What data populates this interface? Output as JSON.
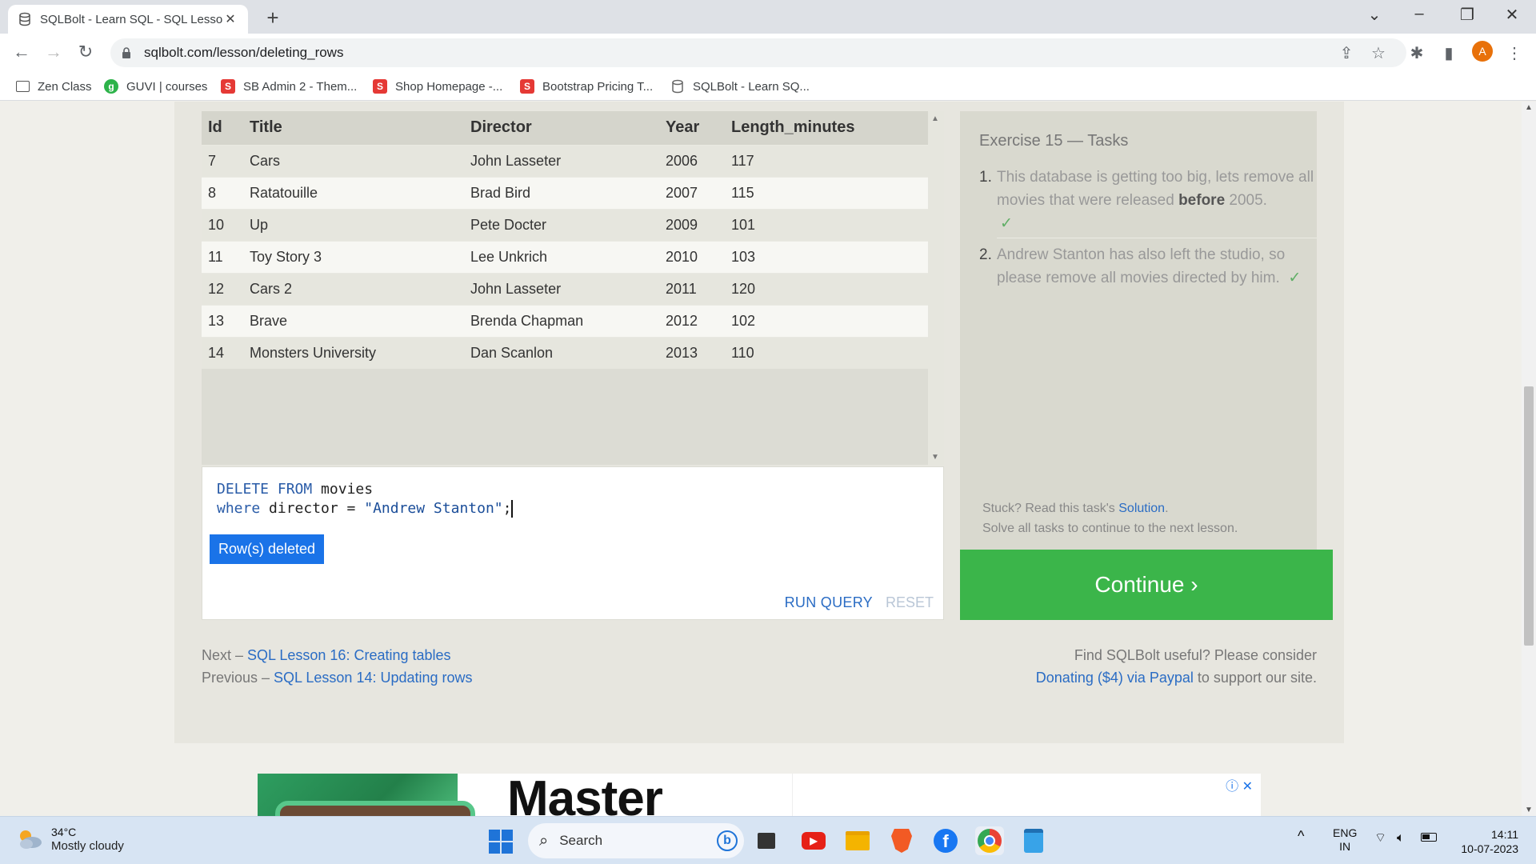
{
  "browser": {
    "tab_title": "SQLBolt - Learn SQL - SQL Lesso",
    "url": "sqlbolt.com/lesson/deleting_rows",
    "profile_initial": "A",
    "bookmarks": [
      {
        "label": "Zen Class",
        "icon_color": "#555555",
        "icon": ""
      },
      {
        "label": "GUVI | courses",
        "icon_color": "#2db34a",
        "icon": "g"
      },
      {
        "label": "SB Admin 2 - Them...",
        "icon_color": "#e53935",
        "icon": "S"
      },
      {
        "label": "Shop Homepage -...",
        "icon_color": "#e53935",
        "icon": "S"
      },
      {
        "label": "Bootstrap Pricing T...",
        "icon_color": "#e53935",
        "icon": "S"
      },
      {
        "label": "SQLBolt - Learn SQ...",
        "icon_color": "#666666",
        "icon": ""
      }
    ]
  },
  "results": {
    "columns": [
      "Id",
      "Title",
      "Director",
      "Year",
      "Length_minutes"
    ],
    "rows": [
      [
        "7",
        "Cars",
        "John Lasseter",
        "2006",
        "117"
      ],
      [
        "8",
        "Ratatouille",
        "Brad Bird",
        "2007",
        "115"
      ],
      [
        "10",
        "Up",
        "Pete Docter",
        "2009",
        "101"
      ],
      [
        "11",
        "Toy Story 3",
        "Lee Unkrich",
        "2010",
        "103"
      ],
      [
        "12",
        "Cars 2",
        "John Lasseter",
        "2011",
        "120"
      ],
      [
        "13",
        "Brave",
        "Brenda Chapman",
        "2012",
        "102"
      ],
      [
        "14",
        "Monsters University",
        "Dan Scanlon",
        "2013",
        "110"
      ]
    ],
    "status": "Row(s) deleted"
  },
  "editor": {
    "line1_kw": "DELETE FROM",
    "line1_rest": " movies",
    "line2_kw": "where",
    "line2_mid": " director = ",
    "line2_str": "\"Andrew Stanton\"",
    "line2_end": ";",
    "run_label": "RUN QUERY",
    "reset_label": "RESET"
  },
  "tasks": {
    "title": "Exercise 15 — Tasks",
    "task1": {
      "num": "1.",
      "pre": "This database is getting too big, lets remove all movies that were released ",
      "bold": "before",
      "post": " 2005.",
      "check": "✓"
    },
    "task2": {
      "num": "2.",
      "text": "Andrew Stanton has also left the studio, so please remove all movies directed by him.",
      "check": "✓"
    },
    "stuck_pre": "Stuck? Read this task's ",
    "stuck_link": "Solution",
    "stuck_post": ".",
    "solve_note": "Solve all tasks to continue to the next lesson.",
    "continue_label": "Continue ›"
  },
  "nav": {
    "next_prefix": "Next – ",
    "next_link": "SQL Lesson 16: Creating tables",
    "prev_prefix": "Previous – ",
    "prev_link": "SQL Lesson 14: Updating rows",
    "support_line1": "Find SQLBolt useful? Please consider",
    "support_link": "Donating ($4) via Paypal",
    "support_post": " to support our site."
  },
  "ad": {
    "headline": "Master"
  },
  "taskbar": {
    "temp": "34°C",
    "condition": "Mostly cloudy",
    "search_placeholder": "Search",
    "lang1": "ENG",
    "lang2": "IN",
    "time": "14:11",
    "date": "10-07-2023"
  },
  "colors": {
    "accent": "#3bb54a",
    "link": "#2a6cc4",
    "status_badge": "#1a73e8"
  }
}
